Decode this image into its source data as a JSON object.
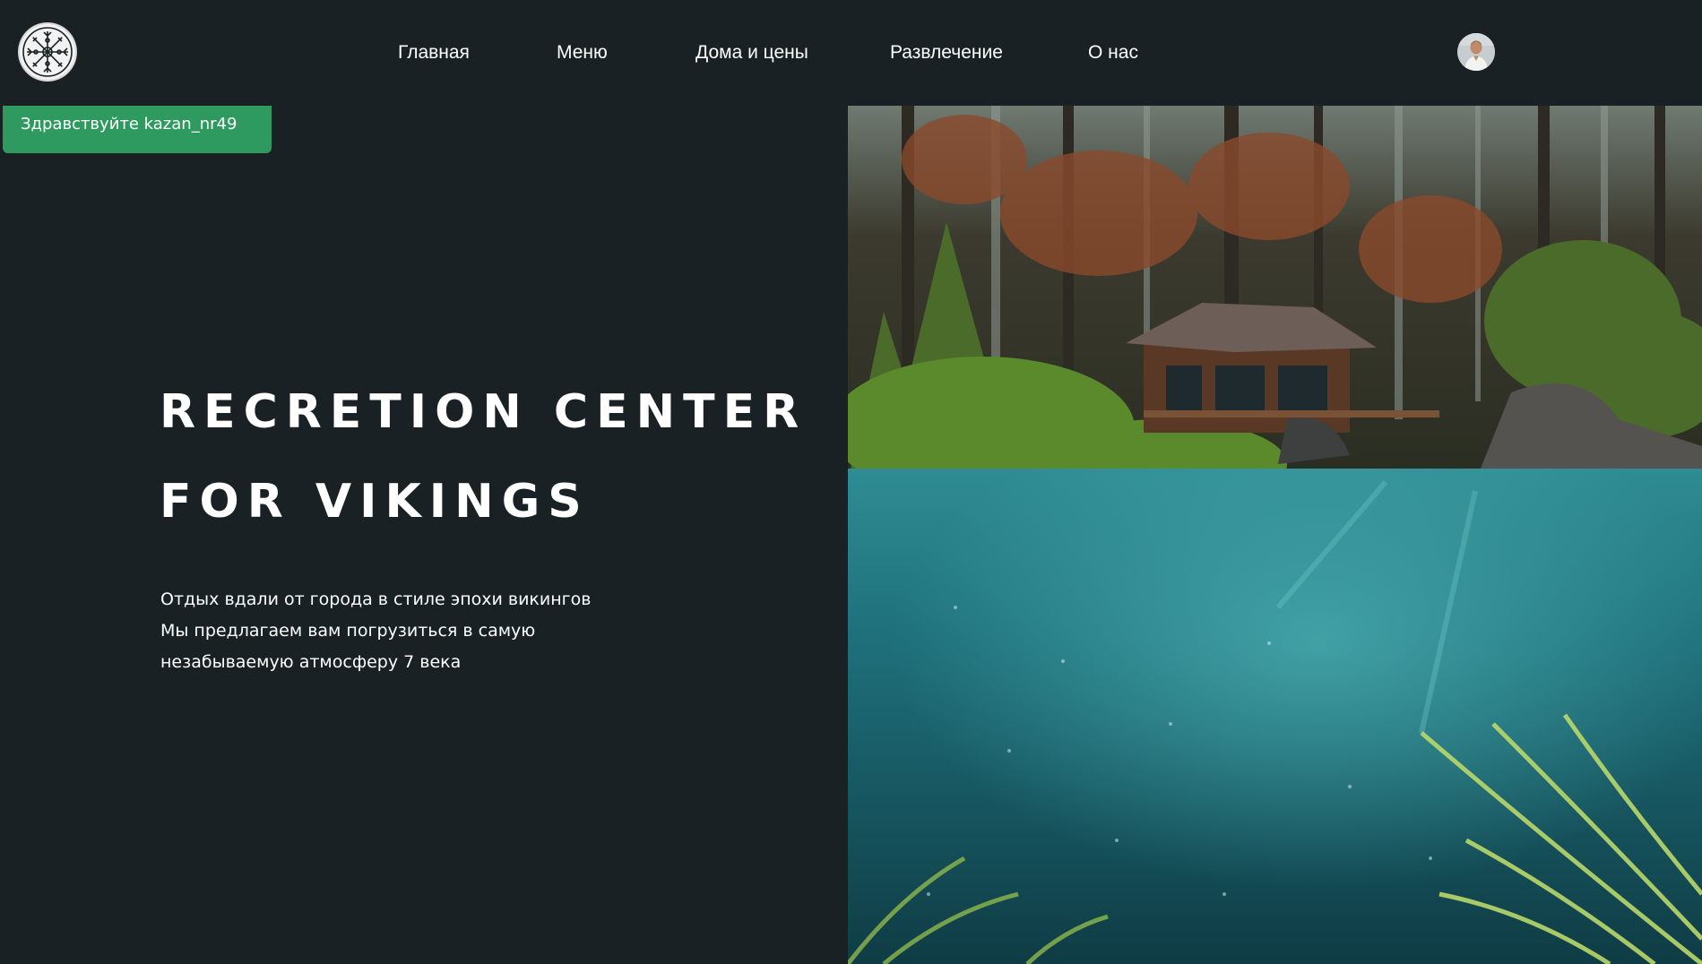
{
  "logo": {
    "icon": "vegvisir-rune-icon"
  },
  "nav": {
    "items": [
      {
        "label": "Главная"
      },
      {
        "label": "Меню"
      },
      {
        "label": "Дома и цены"
      },
      {
        "label": "Развлечение"
      },
      {
        "label": "О нас"
      }
    ]
  },
  "user": {
    "avatar_icon": "user-avatar",
    "greeting": "Здравствуйте kazan_nr49"
  },
  "hero": {
    "title_line1": "RECRETION CENTER",
    "title_line2": "FOR VIKINGS",
    "description": [
      "Отдых вдали от города в стиле эпохи викингов",
      "Мы предлагаем вам погрузиться в самую",
      "незабываемую атмосферу 7 века"
    ],
    "image": "forest-cabin-lake-photo"
  },
  "colors": {
    "background": "#1a2124",
    "accent": "#2f9a5f",
    "text": "#ffffff"
  }
}
